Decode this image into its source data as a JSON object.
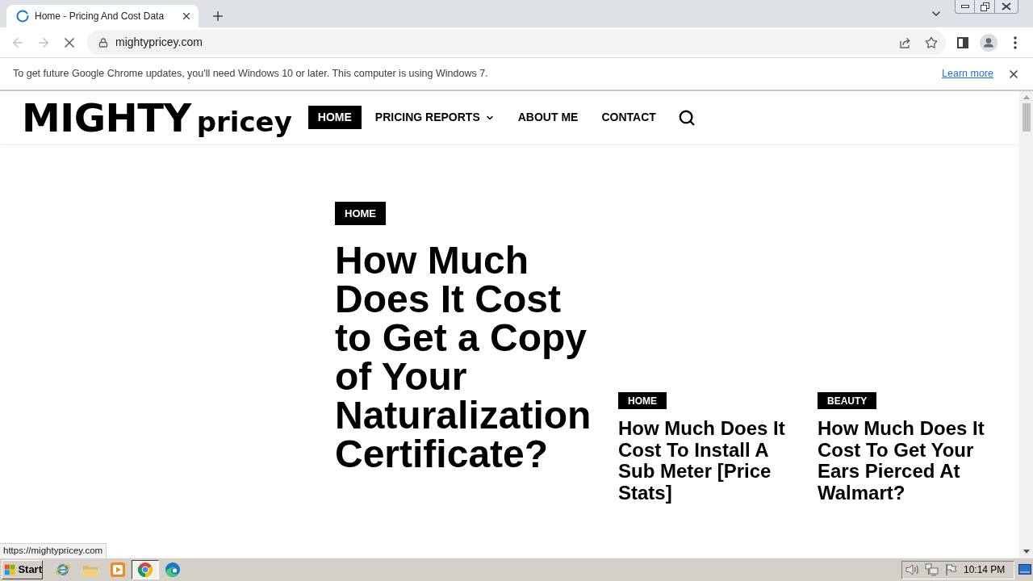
{
  "browser": {
    "tabs": [
      {
        "title": "Home - Pricing And Cost Data",
        "selected": true,
        "loading": true
      }
    ],
    "back": {
      "disabled": true
    },
    "forward": {
      "disabled": true
    },
    "url": "mightypricey.com",
    "status_url": "https://mightypricey.com"
  },
  "infobar": {
    "message": "To get future Google Chrome updates, you'll need Windows 10 or later. This computer is using Windows 7.",
    "link": "Learn more"
  },
  "site": {
    "logo": {
      "primary": "MIGHTY",
      "secondary": "pricey"
    },
    "nav": [
      {
        "label": "HOME",
        "selected": true,
        "kind": "link"
      },
      {
        "label": "PRICING REPORTS",
        "selected": false,
        "kind": "dropdown"
      },
      {
        "label": "ABOUT ME",
        "selected": false,
        "kind": "link"
      },
      {
        "label": "CONTACT",
        "selected": false,
        "kind": "link"
      }
    ]
  },
  "featured": {
    "category": "HOME",
    "title": "How Much Does It Cost to Get a Copy of Your Naturalization Certificate?"
  },
  "articles": [
    {
      "category": "HOME",
      "title": "How Much Does It Cost To Install A Sub Meter [Price Stats]"
    },
    {
      "category": "BEAUTY",
      "title": "How Much Does It Cost To Get Your Ears Pierced At Walmart?"
    }
  ],
  "taskbar": {
    "start": "Start",
    "apps": [
      {
        "kind": "ie",
        "selected": false
      },
      {
        "kind": "folder",
        "selected": false
      },
      {
        "kind": "media",
        "selected": false
      },
      {
        "kind": "chrome",
        "selected": true
      },
      {
        "kind": "edge",
        "selected": false
      }
    ],
    "clock": "10:14 PM"
  }
}
